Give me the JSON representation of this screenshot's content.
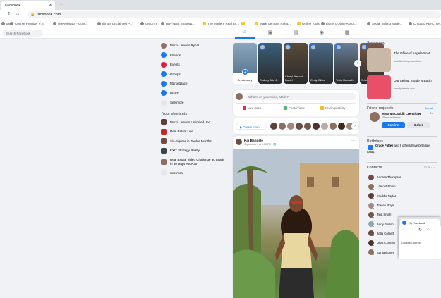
{
  "browser": {
    "tab_title": "Facebook",
    "url": "facebook.com",
    "bookmarks": [
      {
        "label": "gle",
        "icon": "site-icon"
      },
      {
        "label": "Course Provider V.S.",
        "icon": "site-icon"
      },
      {
        "label": "onewebMLS - Cont...",
        "icon": "site-icon"
      },
      {
        "label": "Illinois Unclaimed P...",
        "icon": "site-icon"
      },
      {
        "label": "UMCITY",
        "icon": "site-icon"
      },
      {
        "label": "(89+) Exit Strategy...",
        "icon": "site-icon"
      },
      {
        "label": "The Modern Real Es...",
        "icon": "folder-icon"
      },
      {
        "label": "",
        "icon": "folder-icon"
      },
      {
        "label": "Marki Lemons Ryha...",
        "icon": "folder-icon"
      },
      {
        "label": "Online Tools",
        "icon": "folder-icon"
      },
      {
        "label": "Lionel D'Aime Asso...",
        "icon": "site-icon"
      },
      {
        "label": "Social Selling Made...",
        "icon": "site-icon"
      },
      {
        "label": "Chicago REALTORS...",
        "icon": "site-icon"
      }
    ]
  },
  "facebook": {
    "search_placeholder": "Search Facebook",
    "left_menu": [
      {
        "label": "Marki Lemons Ryhal",
        "color": "#8d6e63"
      },
      {
        "label": "Friends",
        "color": "#1877f2"
      },
      {
        "label": "Events",
        "color": "#e41e3f"
      },
      {
        "label": "Groups",
        "color": "#1877f2"
      },
      {
        "label": "Marketplace",
        "color": "#1877f2"
      },
      {
        "label": "Watch",
        "color": "#1877f2"
      },
      {
        "label": "See more",
        "color": "#e4e6eb"
      }
    ],
    "shortcuts_title": "Your shortcuts",
    "shortcuts": [
      {
        "label": "Marki Lemons Unlimited, Inc."
      },
      {
        "label": "Real Estate Live"
      },
      {
        "label": "Six-Figures in Twelve Months"
      },
      {
        "label": "EXIT Strategy Realty"
      },
      {
        "label": "Real Estate Video Challenge 30 Leads in 30 Days #30N30"
      },
      {
        "label": "See more"
      }
    ],
    "stories": [
      {
        "label": "Create story",
        "type": "create"
      },
      {
        "label": "Rodney Tate Jr.",
        "bg": "#3a5f7a"
      },
      {
        "label": "Cheryl Prescott Daniel",
        "bg": "#5a4a3a"
      },
      {
        "label": "Cindy Gibbs",
        "bg": "#4a6b8a"
      },
      {
        "label": "Tricia Hamarth",
        "bg": "#6a7f9a"
      },
      {
        "label": "Orlando Patrick",
        "bg": "#7a5a4a"
      }
    ],
    "composer": {
      "placeholder": "What's on your mind, Marki?",
      "actions": [
        {
          "label": "Live video",
          "color": "#f02849"
        },
        {
          "label": "Photo/video",
          "color": "#45bd62"
        },
        {
          "label": "Feeling/activity",
          "color": "#f7b928"
        }
      ]
    },
    "rooms": {
      "create_label": "Create room",
      "avatars": [
        "#5d4037",
        "#8d6e63",
        "#a1887f",
        "#6d4c41",
        "#795548",
        "#4e342e",
        "#bcaaa4",
        "#8d6e63",
        "#3e2723",
        "#a1887f"
      ]
    },
    "post": {
      "author": "Kai Bandele",
      "time": "September 1 at 6:05 PM · 🌐"
    },
    "right": {
      "sponsored_title": "Sponsored",
      "ads": [
        {
          "title": "The Office of Angela Scott",
          "url": "theofficeofangelascott.co",
          "color": "#c9b8a8"
        },
        {
          "title": "Our Sellout Shade is Back!",
          "url": "beautybakerie.com",
          "color": "#e8506a"
        }
      ],
      "friend_requests_title": "Friend requests",
      "see_all": "See all",
      "request": {
        "name": "Myra McCaskill Crenshaw",
        "mutual": "15 mutual friends",
        "time": "2w",
        "confirm": "Confirm",
        "delete": "Delete"
      },
      "birthdays_title": "Birthdays",
      "birthday_name": "Grace Fultes",
      "birthday_text": " and 9 others have birthdays today.",
      "contacts_title": "Contacts",
      "contacts": [
        {
          "name": "Andrea Thompson",
          "color": "#6d4c41"
        },
        {
          "name": "Lamont Ebbin",
          "color": "#8d6e63"
        },
        {
          "name": "Freddie Taylor",
          "color": "#5d4037"
        },
        {
          "name": "Tracey Royal",
          "color": "#a1887f"
        },
        {
          "name": "Tina Smith",
          "color": "#795548"
        },
        {
          "name": "Andy Burton",
          "color": "#90a4ae"
        },
        {
          "name": "Itella Colbert",
          "color": "#6d4c41"
        },
        {
          "name": "Dion A. Smith",
          "color": "#4e342e"
        },
        {
          "name": "Sanja Ikonen",
          "color": "#8d6e63"
        }
      ]
    }
  },
  "popup": {
    "tab_title": "(9) Facebook",
    "bookmarks": "Google   Course"
  }
}
